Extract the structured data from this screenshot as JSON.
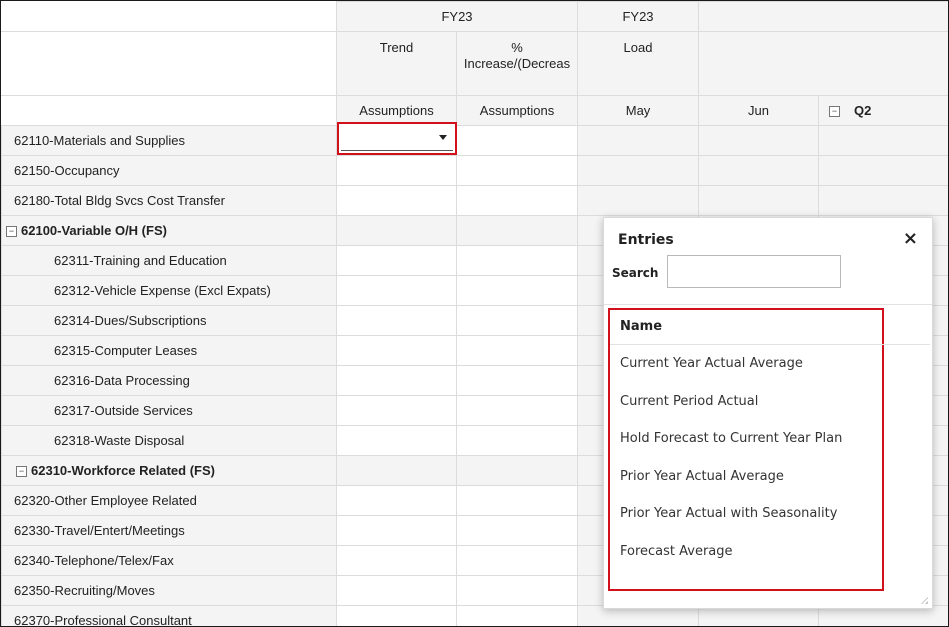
{
  "grid": {
    "header_row1": [
      "FY23",
      "FY23"
    ],
    "header_row2": [
      "Trend",
      "%\nIncrease/(Decreas",
      "Load"
    ],
    "header_row3": [
      "Assumptions",
      "Assumptions",
      "May",
      "Jun",
      "Q2"
    ],
    "rows": [
      "62110-Materials and Supplies",
      "62150-Occupancy",
      "62180-Total Bldg Svcs Cost Transfer",
      "62100-Variable O/H (FS)",
      "62311-Training and Education",
      "62312-Vehicle Expense (Excl Expats)",
      "62314-Dues/Subscriptions",
      "62315-Computer Leases",
      "62316-Data Processing",
      "62317-Outside Services",
      "62318-Waste Disposal",
      "62310-Workforce Related (FS)",
      "62320-Other Employee Related",
      "62330-Travel/Entert/Meetings",
      "62340-Telephone/Telex/Fax",
      "62350-Recruiting/Moves",
      "62370-Professional Consultant"
    ],
    "expander_symbol": "−"
  },
  "popup": {
    "title": "Entries",
    "close_symbol": "×",
    "search_label": "Search",
    "search_value": "",
    "list_header": "Name",
    "entries": [
      "Current Year Actual Average",
      "Current Period Actual",
      "Hold Forecast to Current Year Plan",
      "Prior Year Actual Average",
      "Prior Year Actual with Seasonality",
      "Forecast Average"
    ]
  },
  "colors": {
    "highlight_red": "#d2101c",
    "header_grey": "#f4f4f4"
  }
}
